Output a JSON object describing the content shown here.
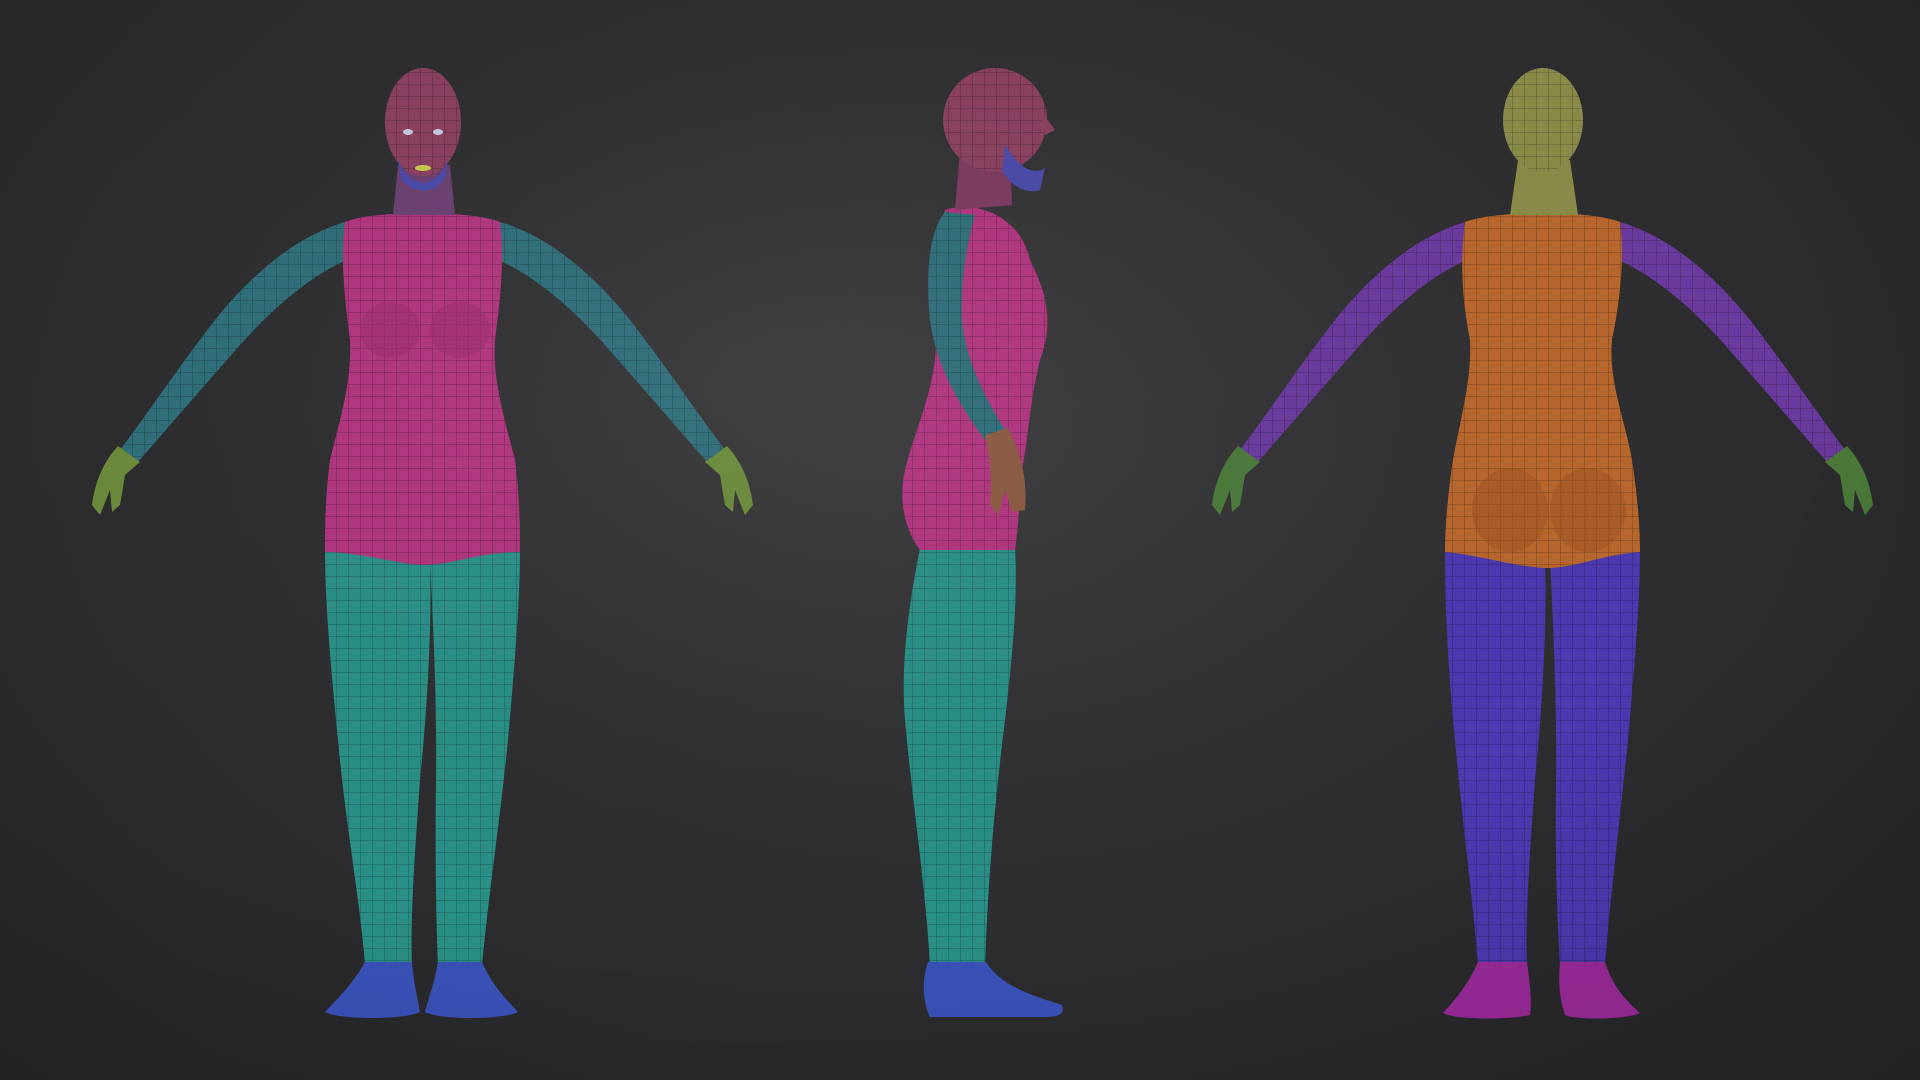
{
  "scene": {
    "background_color": "#2f2f31",
    "views": [
      {
        "name": "front-view"
      },
      {
        "name": "side-view"
      },
      {
        "name": "back-view"
      }
    ],
    "polygroup_colors": {
      "torso_front": "#b0357f",
      "arms_front": "#2f6e7a",
      "legs_front": "#2a8f86",
      "feet_front": "#3a52b8",
      "head": "#8a4060",
      "torso_back": "#b8672e",
      "arms_back": "#6a3a9e",
      "legs_back": "#4b3ab0",
      "feet_back": "#9a2a9a",
      "head_back": "#8a8a48",
      "hands": "#6a8a3a",
      "fingers": "#40b0a8"
    }
  }
}
